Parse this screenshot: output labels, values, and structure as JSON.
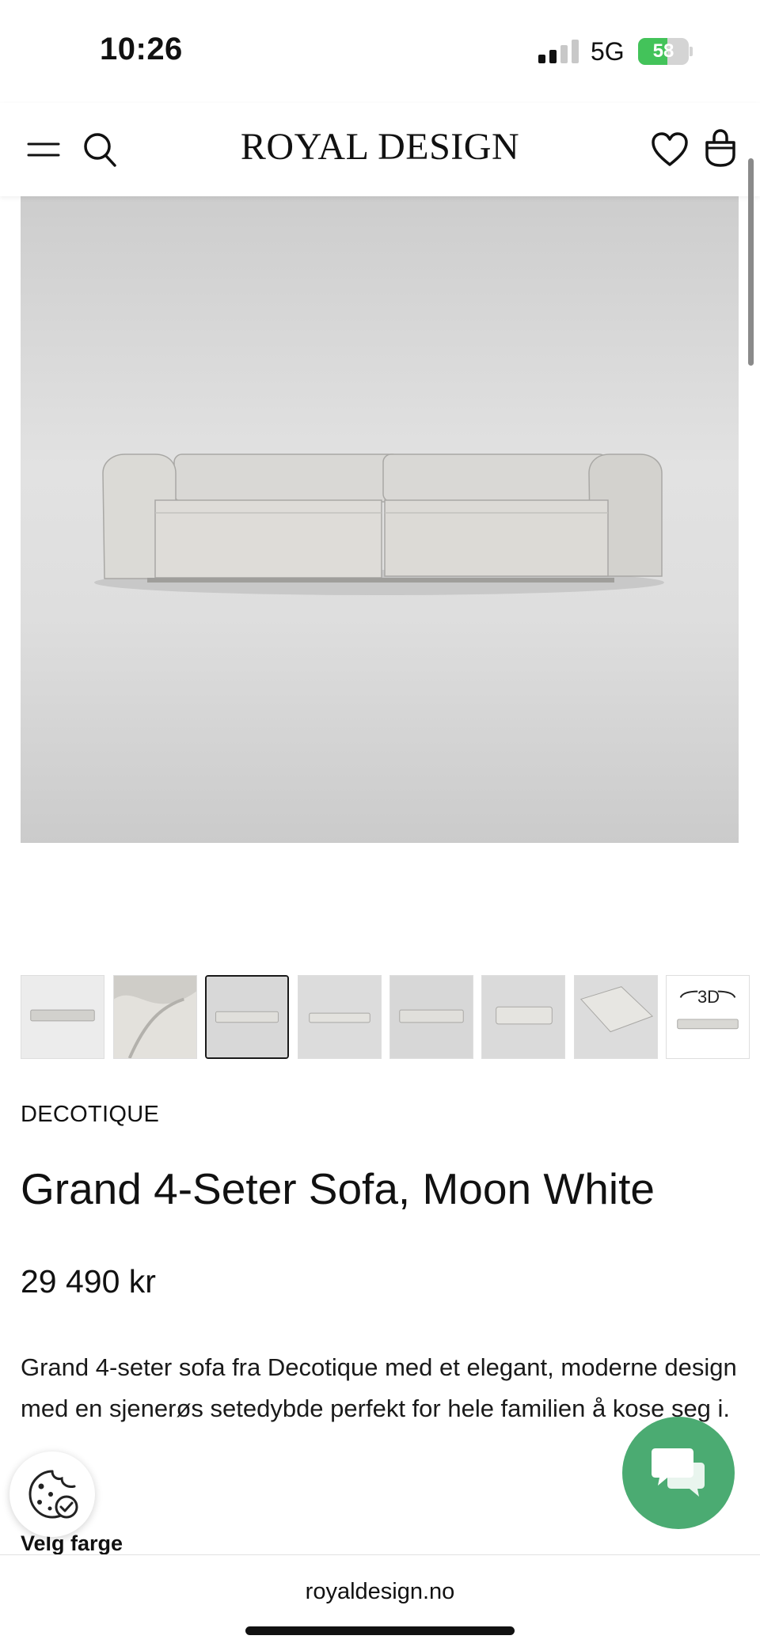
{
  "status_bar": {
    "time": "10:26",
    "network": "5G",
    "battery_percent": 58,
    "battery_label": "58",
    "signal_bars_active": 2,
    "signal_bars_total": 4
  },
  "header": {
    "brand": "ROYAL DESIGN",
    "icons": [
      "menu-icon",
      "search-icon",
      "heart-icon",
      "bag-icon"
    ]
  },
  "hero": {
    "image": "sofa-image"
  },
  "thumbnails": {
    "count": 8,
    "selected_index": 2,
    "items": [
      {
        "kind": "sofa-front"
      },
      {
        "kind": "fabric-closeup"
      },
      {
        "kind": "sofa-front"
      },
      {
        "kind": "sofa-front"
      },
      {
        "kind": "sofa-front"
      },
      {
        "kind": "sofa-angle"
      },
      {
        "kind": "sofa-top"
      },
      {
        "kind": "3d-view",
        "label": "3D"
      }
    ]
  },
  "product": {
    "brand": "DECOTIQUE",
    "title": "Grand 4-Seter Sofa, Moon White",
    "price": "29 490 kr",
    "description": "Grand 4-seter sofa fra Decotique med et elegant, moderne design med en sjenerøs setedybde perfekt for hele familien å kose seg i.",
    "color_label": "Velg farge"
  },
  "floating": {
    "chat_icon": "chat-icon",
    "cookie_icon": "cookie-icon"
  },
  "browser": {
    "url": "royaldesign.no"
  },
  "colors": {
    "accent_green": "#4bab72",
    "battery_green": "#43c35a",
    "text": "#111111",
    "hero_bg": "#dcdcdc"
  }
}
